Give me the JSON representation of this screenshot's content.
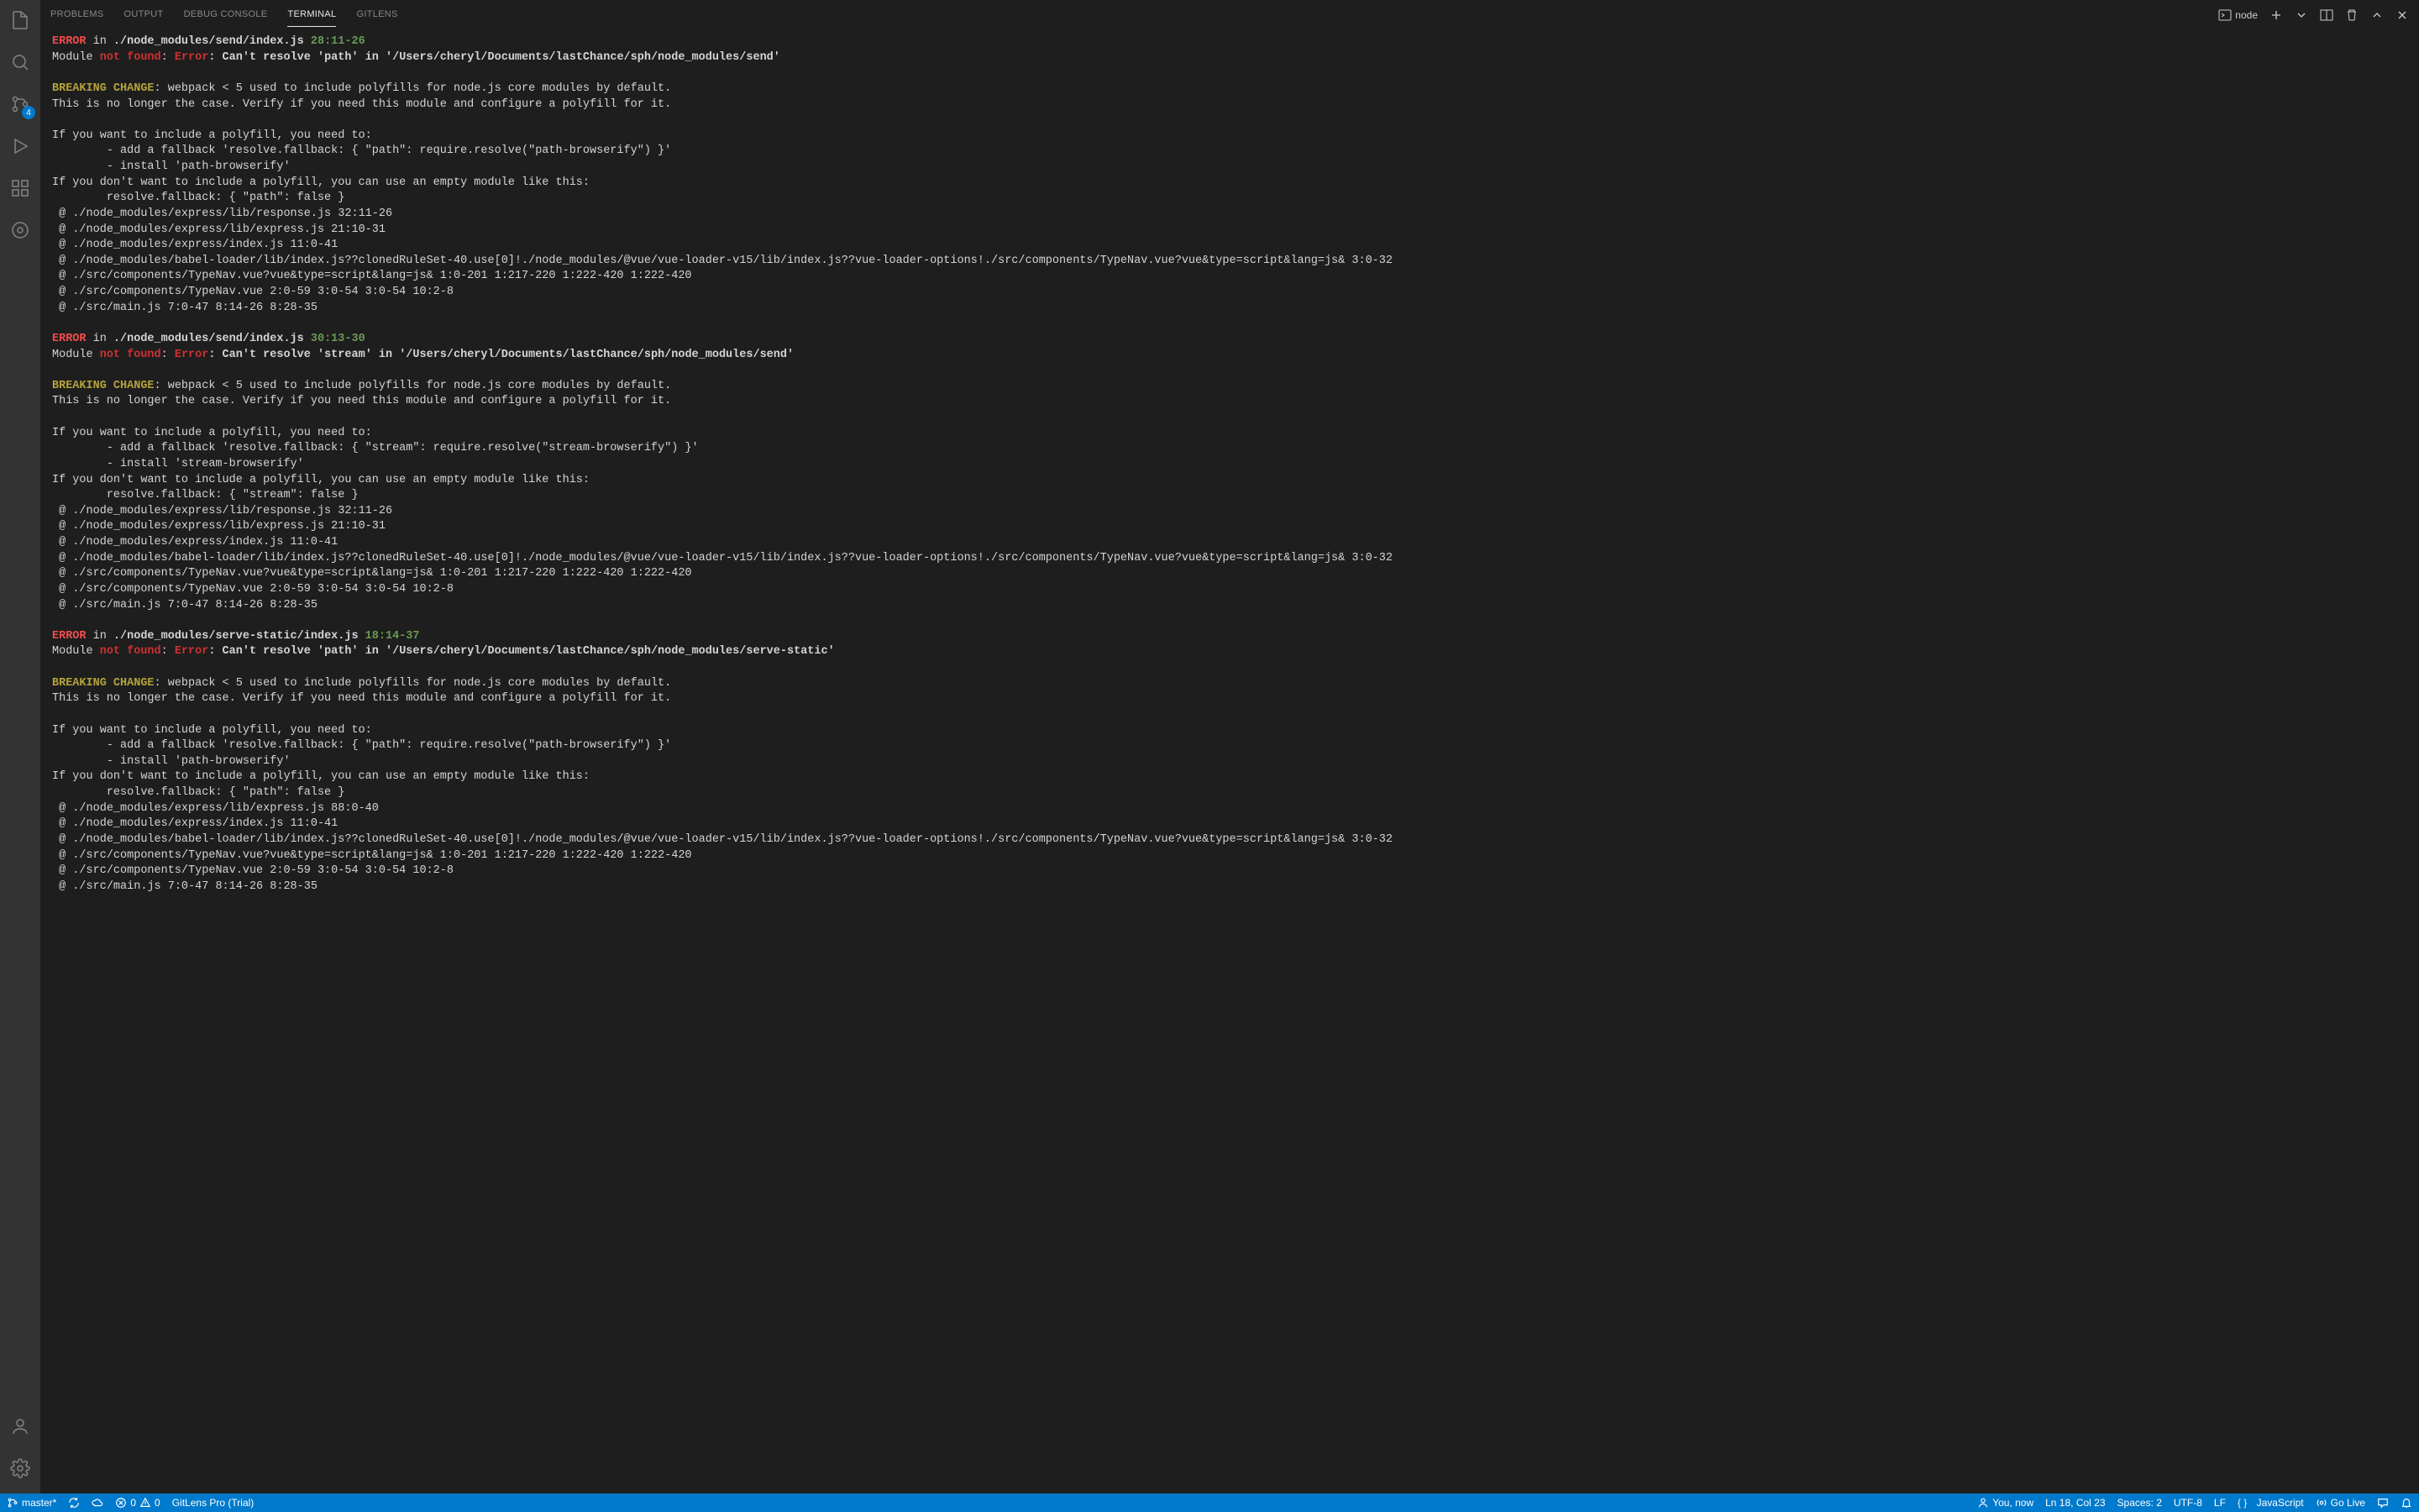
{
  "activityBar": {
    "scmBadge": "4"
  },
  "panel": {
    "tabs": [
      "PROBLEMS",
      "OUTPUT",
      "DEBUG CONSOLE",
      "TERMINAL",
      "GITLENS"
    ],
    "activeTab": "TERMINAL",
    "shellName": "node"
  },
  "terminal": {
    "blocks": [
      {
        "errLine": {
          "error": "ERROR",
          "in": " in ",
          "file": "./node_modules/send/index.js",
          "loc": " 28:11-26"
        },
        "modLine": {
          "mod": "Module ",
          "nf": "not found",
          "colon": ": ",
          "err": "Error",
          "rest": ": Can't resolve 'path' in '/Users/cheryl/Documents/lastChance/sph/node_modules/send'"
        },
        "bc": "BREAKING CHANGE",
        "bcRest": ": webpack < 5 used to include polyfills for node.js core modules by default.\nThis is no longer the case. Verify if you need this module and configure a polyfill for it.\n\nIf you want to include a polyfill, you need to:\n        - add a fallback 'resolve.fallback: { \"path\": require.resolve(\"path-browserify\") }'\n        - install 'path-browserify'\nIf you don't want to include a polyfill, you can use an empty module like this:\n        resolve.fallback: { \"path\": false }\n @ ./node_modules/express/lib/response.js 32:11-26\n @ ./node_modules/express/lib/express.js 21:10-31\n @ ./node_modules/express/index.js 11:0-41\n @ ./node_modules/babel-loader/lib/index.js??clonedRuleSet-40.use[0]!./node_modules/@vue/vue-loader-v15/lib/index.js??vue-loader-options!./src/components/TypeNav.vue?vue&type=script&lang=js& 3:0-32\n @ ./src/components/TypeNav.vue?vue&type=script&lang=js& 1:0-201 1:217-220 1:222-420 1:222-420\n @ ./src/components/TypeNav.vue 2:0-59 3:0-54 3:0-54 10:2-8\n @ ./src/main.js 7:0-47 8:14-26 8:28-35"
      },
      {
        "errLine": {
          "error": "ERROR",
          "in": " in ",
          "file": "./node_modules/send/index.js",
          "loc": " 30:13-30"
        },
        "modLine": {
          "mod": "Module ",
          "nf": "not found",
          "colon": ": ",
          "err": "Error",
          "rest": ": Can't resolve 'stream' in '/Users/cheryl/Documents/lastChance/sph/node_modules/send'"
        },
        "bc": "BREAKING CHANGE",
        "bcRest": ": webpack < 5 used to include polyfills for node.js core modules by default.\nThis is no longer the case. Verify if you need this module and configure a polyfill for it.\n\nIf you want to include a polyfill, you need to:\n        - add a fallback 'resolve.fallback: { \"stream\": require.resolve(\"stream-browserify\") }'\n        - install 'stream-browserify'\nIf you don't want to include a polyfill, you can use an empty module like this:\n        resolve.fallback: { \"stream\": false }\n @ ./node_modules/express/lib/response.js 32:11-26\n @ ./node_modules/express/lib/express.js 21:10-31\n @ ./node_modules/express/index.js 11:0-41\n @ ./node_modules/babel-loader/lib/index.js??clonedRuleSet-40.use[0]!./node_modules/@vue/vue-loader-v15/lib/index.js??vue-loader-options!./src/components/TypeNav.vue?vue&type=script&lang=js& 3:0-32\n @ ./src/components/TypeNav.vue?vue&type=script&lang=js& 1:0-201 1:217-220 1:222-420 1:222-420\n @ ./src/components/TypeNav.vue 2:0-59 3:0-54 3:0-54 10:2-8\n @ ./src/main.js 7:0-47 8:14-26 8:28-35"
      },
      {
        "errLine": {
          "error": "ERROR",
          "in": " in ",
          "file": "./node_modules/serve-static/index.js",
          "loc": " 18:14-37"
        },
        "modLine": {
          "mod": "Module ",
          "nf": "not found",
          "colon": ": ",
          "err": "Error",
          "rest": ": Can't resolve 'path' in '/Users/cheryl/Documents/lastChance/sph/node_modules/serve-static'"
        },
        "bc": "BREAKING CHANGE",
        "bcRest": ": webpack < 5 used to include polyfills for node.js core modules by default.\nThis is no longer the case. Verify if you need this module and configure a polyfill for it.\n\nIf you want to include a polyfill, you need to:\n        - add a fallback 'resolve.fallback: { \"path\": require.resolve(\"path-browserify\") }'\n        - install 'path-browserify'\nIf you don't want to include a polyfill, you can use an empty module like this:\n        resolve.fallback: { \"path\": false }\n @ ./node_modules/express/lib/express.js 88:0-40\n @ ./node_modules/express/index.js 11:0-41\n @ ./node_modules/babel-loader/lib/index.js??clonedRuleSet-40.use[0]!./node_modules/@vue/vue-loader-v15/lib/index.js??vue-loader-options!./src/components/TypeNav.vue?vue&type=script&lang=js& 3:0-32\n @ ./src/components/TypeNav.vue?vue&type=script&lang=js& 1:0-201 1:217-220 1:222-420 1:222-420\n @ ./src/components/TypeNav.vue 2:0-59 3:0-54 3:0-54 10:2-8\n @ ./src/main.js 7:0-47 8:14-26 8:28-35"
      }
    ]
  },
  "status": {
    "branch": "master*",
    "errors": "0",
    "warnings": "0",
    "gitlens": "GitLens Pro (Trial)",
    "blame": "You, now",
    "lncol": "Ln 18, Col 23",
    "spaces": "Spaces: 2",
    "encoding": "UTF-8",
    "eol": "LF",
    "language": "JavaScript",
    "goLive": "Go Live"
  }
}
